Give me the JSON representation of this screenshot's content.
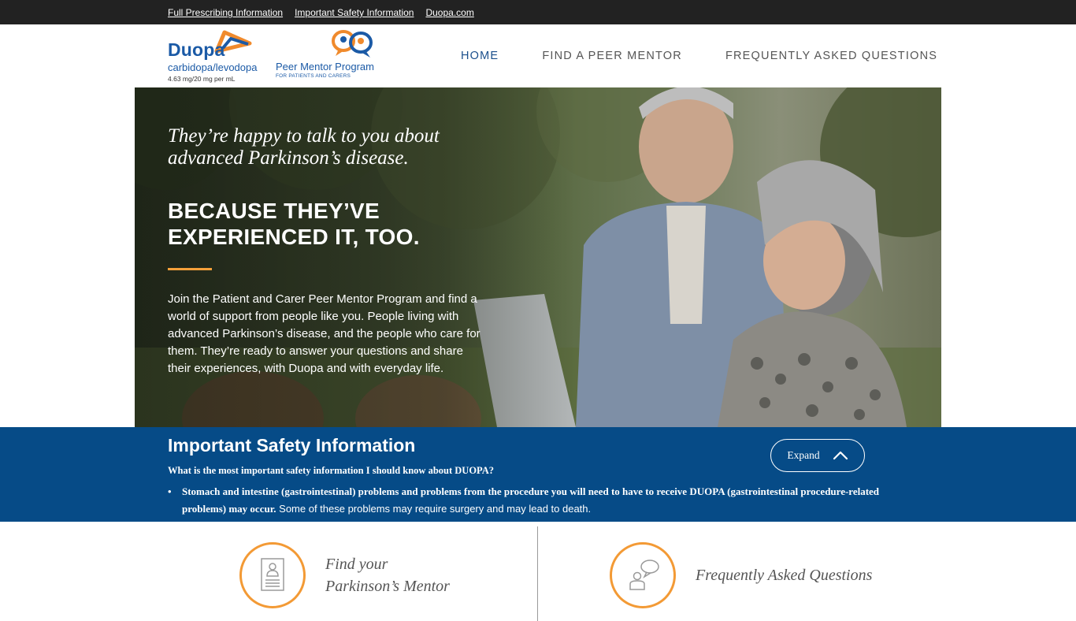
{
  "utility_bar": {
    "links": [
      {
        "label": "Full Prescribing Information"
      },
      {
        "label": "Important Safety Information"
      },
      {
        "label": "Duopa.com"
      }
    ]
  },
  "header": {
    "duopa_logo": {
      "brand": "Duopa",
      "generic": "carbidopa/levodopa",
      "dose": "4.63 mg/20 mg per mL"
    },
    "pmp_logo": {
      "title": "Peer Mentor Program",
      "subtitle": "FOR PATIENTS AND CARERS"
    },
    "nav": [
      {
        "label": "HOME",
        "active": true
      },
      {
        "label": "FIND A PEER MENTOR",
        "active": false
      },
      {
        "label": "FREQUENTLY ASKED QUESTIONS",
        "active": false
      }
    ]
  },
  "hero": {
    "tagline": "They’re happy to talk to you about advanced Parkinson’s disease.",
    "headline_line1": "BECAUSE THEY’VE",
    "headline_line2": "EXPERIENCED IT, TOO.",
    "body": "Join the Patient and Carer Peer Mentor Program and find a world of support from people like you. People living with advanced Parkinson’s disease, and the people who care for them. They’re ready to answer your questions and share their experiences, with Duopa and with everyday life."
  },
  "isi": {
    "title": "Important Safety Information",
    "question": "What is the most important safety information I should know about DUOPA?",
    "bullet_bold": "Stomach and intestine (gastrointestinal) problems and problems from the procedure you will need to have to receive DUOPA (gastrointestinal procedure-related problems) may occur.",
    "bullet_regular": " Some of these problems may require surgery and may lead to death.",
    "expand_label": "Expand"
  },
  "features": {
    "mentor": {
      "line1": "Find your",
      "line2": "Parkinson’s Mentor",
      "icon": "mentor-profile-icon"
    },
    "faq": {
      "label": "Frequently Asked Questions",
      "icon": "faq-chat-icon"
    }
  },
  "colors": {
    "brand_blue": "#1b5aa6",
    "isi_blue": "#064b87",
    "accent_orange": "#f39a35",
    "utility_bar": "#222222"
  }
}
